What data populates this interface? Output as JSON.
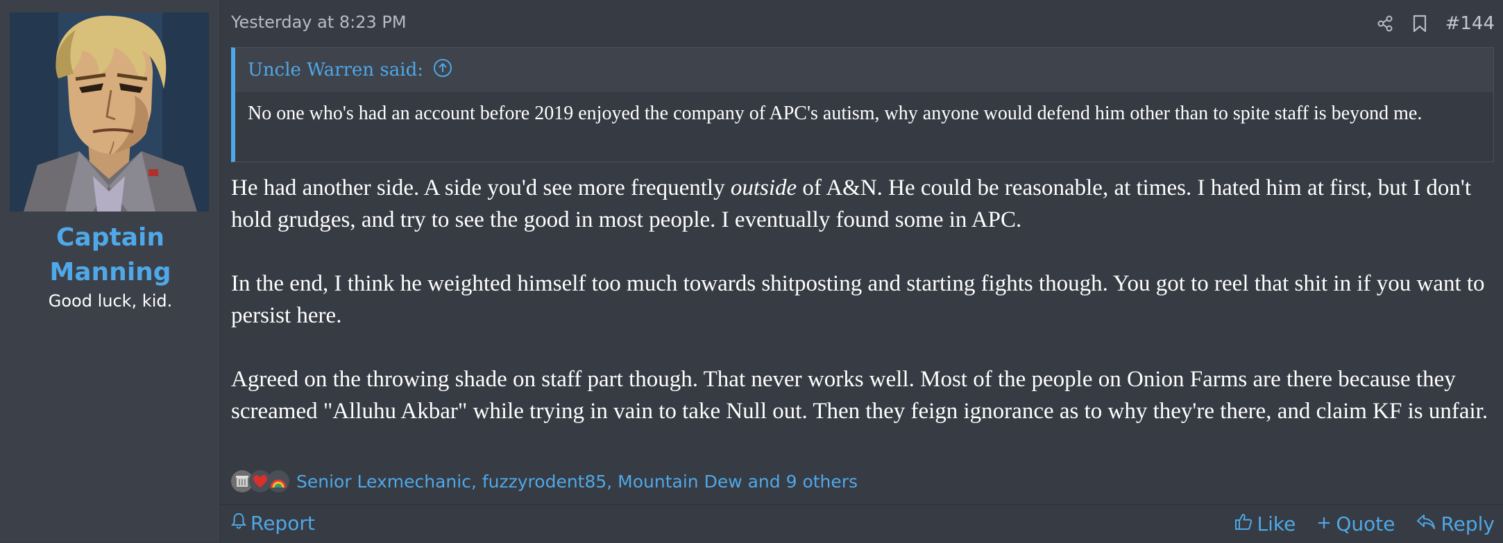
{
  "author": {
    "name_line1": "Captain",
    "name_line2": "Manning",
    "title": "Good luck, kid."
  },
  "post": {
    "date": "Yesterday at 8:23 PM",
    "number": "#144",
    "quote": {
      "author_label": "Uncle Warren said:",
      "text": "No one who's had an account before 2019 enjoyed the company of APC's autism, why anyone would defend him other than to spite staff is beyond me."
    },
    "paragraphs": [
      {
        "before": "He had another side. A side you'd see more frequently ",
        "emphasis": "outside",
        "after": " of A&N. He could be reasonable, at times. I hated him at first, but I don't hold grudges, and try to see the good in most people. I eventually found some in APC."
      },
      {
        "text": "In the end, I think he weighted himself too much towards shitposting and starting fights though. You got to reel that shit in if you want to persist here."
      },
      {
        "text": "Agreed on the throwing shade on staff part though. That never works well. Most of the people on Onion Farms are there because they screamed \"Alluhu Akbar\" while trying in vain to take Null out. Then they feign ignorance as to why they're there, and claim KF is unfair."
      }
    ],
    "reactions": {
      "icons": [
        "dumpster-icon",
        "heart-icon",
        "rainbow-icon"
      ],
      "list_text": "Senior Lexmechanic, fuzzyrodent85, Mountain Dew and 9 others"
    }
  },
  "footer": {
    "report_label": "Report",
    "like_label": "Like",
    "quote_label": "Quote",
    "reply_label": "Reply"
  },
  "colors": {
    "accent": "#4fa8e8",
    "background": "#373b43",
    "sidebar": "#3c4049"
  }
}
